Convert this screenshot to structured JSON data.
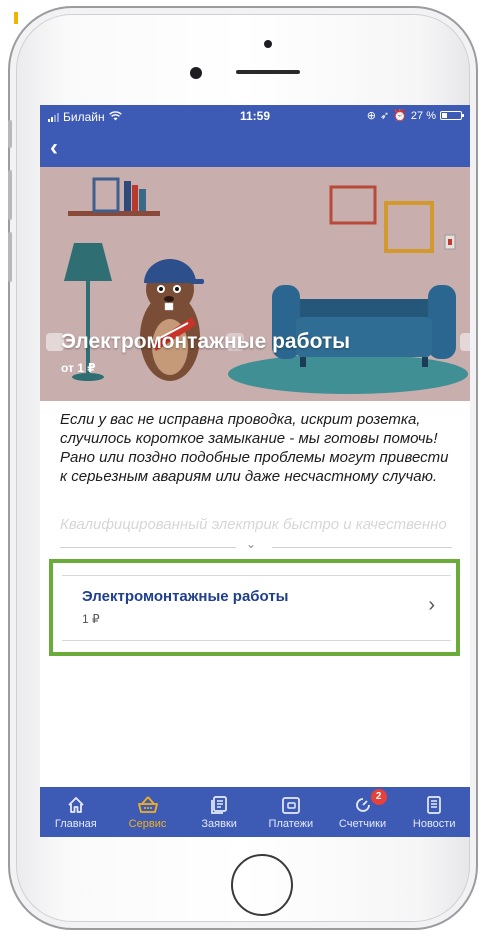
{
  "status_bar": {
    "carrier": "Билайн",
    "time": "11:59",
    "battery": "27 %",
    "battery_level": 0.27
  },
  "nav": {
    "back_icon": "chevron-left-icon"
  },
  "hero": {
    "title": "Электромонтажные работы",
    "price": "от 1 ₽"
  },
  "description": {
    "text": "Если у вас не исправна проводка, искрит розетка, случилось короткое замыкание - мы готовы помочь! Рано или поздно подобные проблемы могут привести к серьезным авариям или даже несчастному случаю.",
    "faded_text": "Квалифицированный электрик быстро и качественно"
  },
  "service_item": {
    "name": "Электромонтажные работы",
    "price": "1 ₽"
  },
  "tabs": [
    {
      "label": "Главная",
      "icon": "home-icon",
      "active": false
    },
    {
      "label": "Сервис",
      "icon": "basket-icon",
      "active": true
    },
    {
      "label": "Заявки",
      "icon": "requests-icon",
      "active": false
    },
    {
      "label": "Платежи",
      "icon": "wallet-icon",
      "active": false
    },
    {
      "label": "Счетчики",
      "icon": "meter-icon",
      "active": false,
      "badge": "2"
    },
    {
      "label": "Новости",
      "icon": "news-icon",
      "active": false
    }
  ],
  "colors": {
    "brand_blue": "#3d5ab5",
    "active_tab": "#f2b01e",
    "highlight_green": "#6aab3a",
    "badge_red": "#e8413a"
  }
}
